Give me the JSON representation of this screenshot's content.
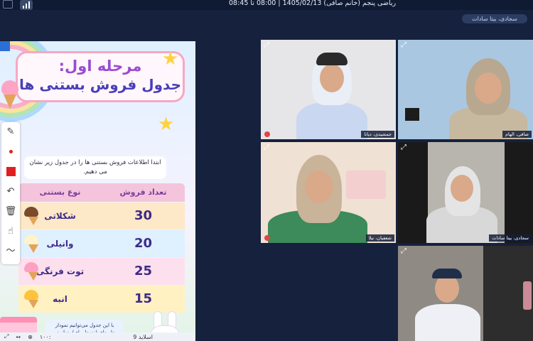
{
  "header": {
    "title": "ریاضی پنجم (خانم صافی) 1405/02/13 | 08:00 تا 08:45",
    "user_chip": "سجادی، بیتا سادات"
  },
  "slide": {
    "title_line1": "مرحله اول:",
    "title_line2": "جدول فروش بستنی ها",
    "intro": "ابتدا اطلاعات فروش بستنی ها را در جدول زیر نشان می دهیم.",
    "table": {
      "headers": [
        "تعداد فروش",
        "نوع بستنی"
      ],
      "rows": [
        {
          "count": "30",
          "name": "شکلاتی",
          "color": "#7a4a2a"
        },
        {
          "count": "20",
          "name": "وانیلی",
          "color": "#fff3c9"
        },
        {
          "count": "25",
          "name": "توت فرنگی",
          "color": "#ff9fc2"
        },
        {
          "count": "15",
          "name": "انبه",
          "color": "#ffc23d"
        }
      ]
    },
    "bottom_note": "با این جدول می‌توانیم نمودار دایره‌ای (نمودار پای) بسازیم.",
    "nav": {
      "zoom": "۱۰۰:",
      "slide_label": "اسلاید 9"
    }
  },
  "toolbar": {
    "tools": [
      {
        "name": "pen-tool",
        "glyph": "✎"
      },
      {
        "name": "color-dot-tool",
        "glyph": ""
      },
      {
        "name": "fill-color-tool",
        "glyph": ""
      },
      {
        "name": "undo-tool",
        "glyph": "↶"
      },
      {
        "name": "delete-tool",
        "glyph": "🗑"
      },
      {
        "name": "pointer-tool",
        "glyph": "☝"
      },
      {
        "name": "line-tool",
        "glyph": "〜"
      }
    ]
  },
  "participants": [
    {
      "name": "جمشیدی، دیانا",
      "mic_off": true
    },
    {
      "name": "صافی، الهام",
      "mic_off": false
    },
    {
      "name": "شعفیان، نیلا",
      "mic_off": true
    },
    {
      "name": "سجادی، بیتا سادات",
      "mic_off": false
    },
    {
      "name": "",
      "mic_off": false
    }
  ],
  "colors": {
    "background": "#15213d",
    "accent": "#2b6fd6"
  }
}
